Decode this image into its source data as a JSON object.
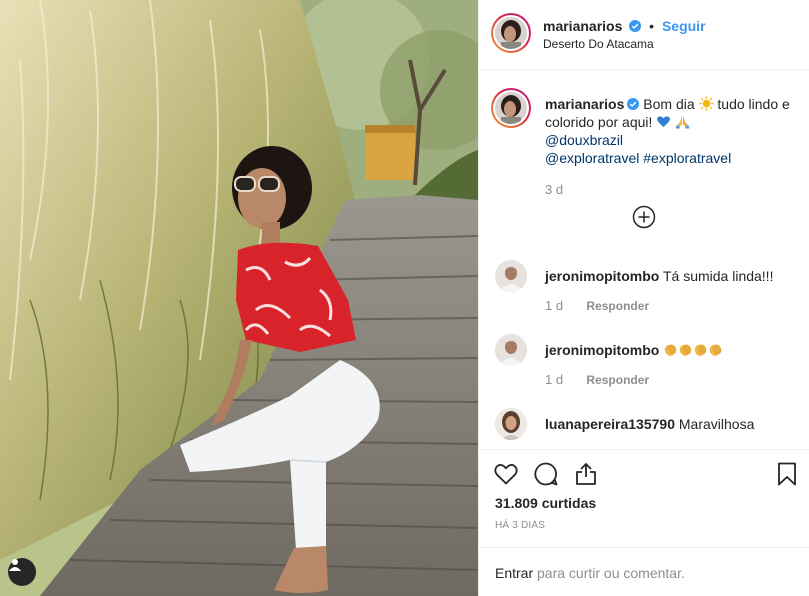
{
  "post": {
    "username": "marianarios",
    "follow_label": "Seguir",
    "separator": "•",
    "location": "Deserto Do Atacama"
  },
  "caption": {
    "username": "marianarios",
    "text_1": "Bom dia",
    "text_2": "tudo lindo e colorido por aqui!",
    "mention": "@douxbrazil",
    "mention2": "@exploratravel",
    "hashtag": "#exploratravel",
    "time": "3 d"
  },
  "comments": [
    {
      "username": "jeronimopitombo",
      "text": "Tá sumida linda!!!",
      "time": "1 d",
      "reply": "Responder"
    },
    {
      "username": "jeronimopitombo",
      "text": "",
      "time": "1 d",
      "reply": "Responder"
    },
    {
      "username": "luanapereira135790",
      "text": "Maravilhosa",
      "time": "",
      "reply": ""
    }
  ],
  "stats": {
    "likes": "31.809 curtidas",
    "ago": "HÁ 3 DIAS"
  },
  "login": {
    "enter": "Entrar",
    "rest": " para curtir ou comentar."
  },
  "icons": {
    "verified": "verified-badge-icon",
    "like": "heart-icon",
    "comment": "comment-bubble-icon",
    "share": "share-icon",
    "save": "bookmark-icon",
    "load_more": "plus-circle-icon",
    "user_tags": "person-icon"
  },
  "colors": {
    "accent": "#3897f0",
    "link": "#003569",
    "muted": "#8e8e8e",
    "text": "#262626"
  }
}
